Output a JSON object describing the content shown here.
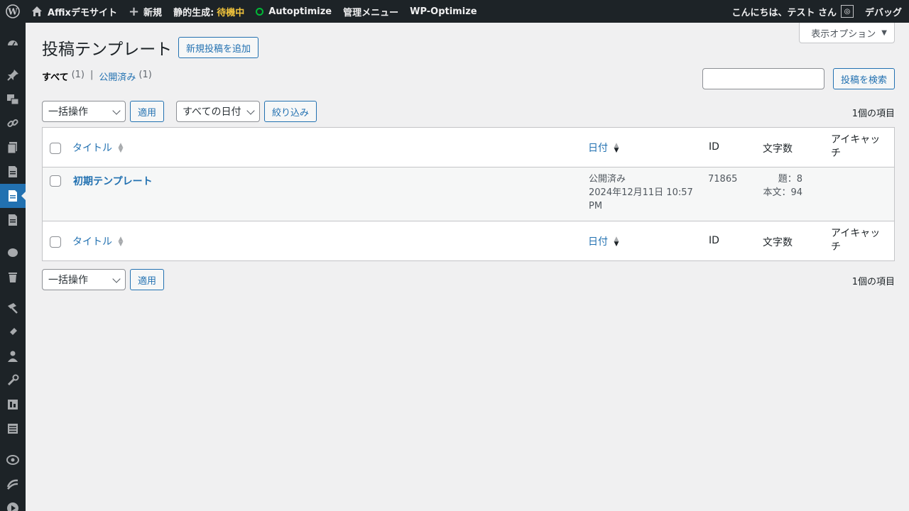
{
  "adminbar": {
    "site_name": "Affixデモサイト",
    "new_label": "新規",
    "static_label": "静的生成:",
    "static_status": "待機中",
    "autoptimize": "Autoptimize",
    "admin_menu": "管理メニュー",
    "wp_optimize": "WP-Optimize",
    "greeting": "こんにちは、テスト さん",
    "debug": "デバッグ"
  },
  "screen_options": "表示オプション",
  "page": {
    "title": "投稿テンプレート",
    "add_new": "新規投稿を追加"
  },
  "filters": {
    "all_label": "すべて",
    "all_count": "(1)",
    "separator": "|",
    "published_label": "公開済み",
    "published_count": "(1)"
  },
  "search": {
    "button": "投稿を検索",
    "value": ""
  },
  "tablenav_top": {
    "bulk_action": "一括操作",
    "apply": "適用",
    "date_filter": "すべての日付",
    "filter_button": "絞り込み",
    "count": "1個の項目"
  },
  "tablenav_bottom": {
    "bulk_action": "一括操作",
    "apply": "適用",
    "count": "1個の項目"
  },
  "table": {
    "columns": {
      "title": "タイトル",
      "date": "日付",
      "id": "ID",
      "chars": "文字数",
      "eyecatch_line1": "アイキャッ",
      "eyecatch_line2": "チ"
    },
    "rows": [
      {
        "title": "初期テンプレート",
        "status": "公開済み",
        "date": "2024年12月11日 10:57",
        "time_suffix": "PM",
        "id": "71865",
        "chars_title": "題：8",
        "chars_body": "本文：94"
      }
    ]
  }
}
